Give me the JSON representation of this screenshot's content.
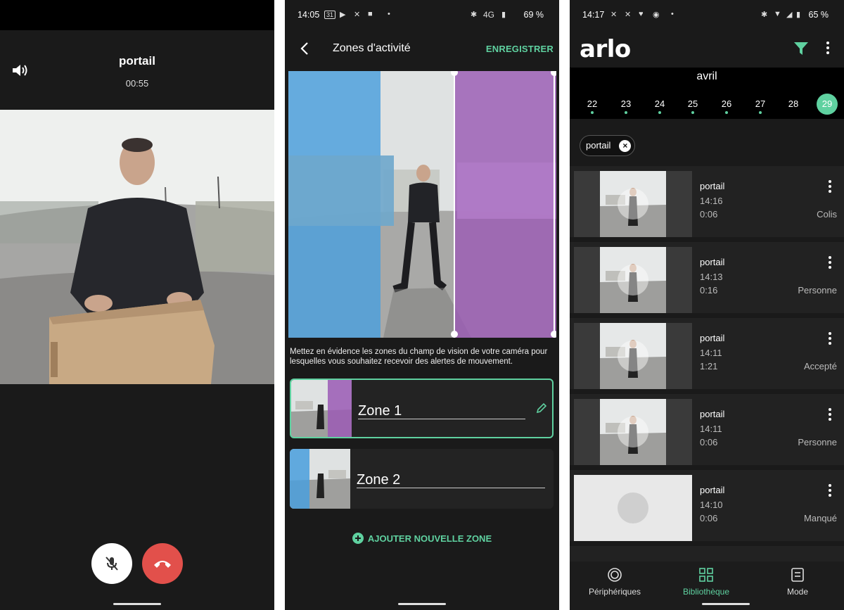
{
  "call_screen": {
    "camera_name": "portail",
    "duration": "00:55",
    "icons": [
      "speaker-icon",
      "mic-off-icon",
      "hang-up-icon"
    ]
  },
  "zones_screen": {
    "status_time": "14:05",
    "status_calendar_day": "31",
    "status_network": "4G",
    "status_battery": "69 %",
    "title": "Zones d'activité",
    "save_label": "ENREGISTRER",
    "description": "Mettez en évidence les zones du champ de vision de votre caméra pour lesquelles vous souhaitez recevoir des alertes de mouvement.",
    "zones": [
      {
        "label": "Zone 1",
        "color": "#9b5bb5"
      },
      {
        "label": "Zone 2",
        "color": "#4a9fdd"
      }
    ],
    "add_zone_label": "AJOUTER NOUVELLE ZONE",
    "accent_color": "#5fd1a0"
  },
  "library_screen": {
    "status_time": "14:17",
    "status_battery": "65 %",
    "logo_text": "arlo",
    "month": "avril",
    "days": [
      {
        "label": "22",
        "has_events": true,
        "selected": false
      },
      {
        "label": "23",
        "has_events": true,
        "selected": false
      },
      {
        "label": "24",
        "has_events": true,
        "selected": false
      },
      {
        "label": "25",
        "has_events": true,
        "selected": false
      },
      {
        "label": "26",
        "has_events": true,
        "selected": false
      },
      {
        "label": "27",
        "has_events": true,
        "selected": false
      },
      {
        "label": "28",
        "has_events": false,
        "selected": false
      },
      {
        "label": "29",
        "has_events": false,
        "selected": true
      }
    ],
    "filter_chip": "portail",
    "recordings": [
      {
        "camera": "portail",
        "time": "14:16",
        "duration": "0:06",
        "status": "Colis"
      },
      {
        "camera": "portail",
        "time": "14:13",
        "duration": "0:16",
        "status": "Personne"
      },
      {
        "camera": "portail",
        "time": "14:11",
        "duration": "1:21",
        "status": "Accepté"
      },
      {
        "camera": "portail",
        "time": "14:11",
        "duration": "0:06",
        "status": "Personne"
      },
      {
        "camera": "portail",
        "time": "14:10",
        "duration": "0:06",
        "status": "Manqué"
      }
    ],
    "tabs": [
      {
        "label": "Périphériques",
        "active": false
      },
      {
        "label": "Bibliothèque",
        "active": true
      },
      {
        "label": "Mode",
        "active": false
      }
    ]
  }
}
